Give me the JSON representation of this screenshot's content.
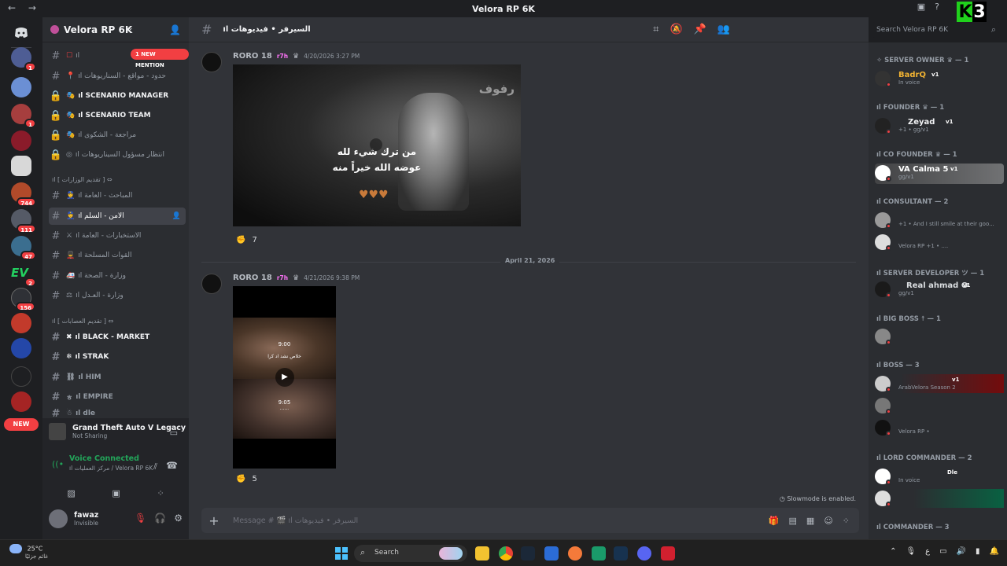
{
  "window": {
    "title": "Velora RP 6K",
    "back": "←",
    "forward": "→"
  },
  "watermark": {
    "k": "K",
    "n": "3"
  },
  "guilds": {
    "badges": [
      "1",
      "1",
      "1",
      "744",
      "111",
      "47",
      "2",
      "156"
    ],
    "ev_label": "EV",
    "new_label": "NEW"
  },
  "sidebar": {
    "server_name": "Velora RP 6K",
    "mention_pill": "1 NEW MENTION",
    "channels": [
      {
        "label": "ıl",
        "icon": "☐",
        "type": "hash"
      },
      {
        "label": "ıl حدود - مواقع - السناريوهات",
        "icon": "📍",
        "type": "hash"
      },
      {
        "label": "ıl SCENARIO MANAGER",
        "icon": "🎭",
        "type": "lock",
        "bold": true
      },
      {
        "label": "ıl SCENARIO TEAM",
        "icon": "🎭",
        "type": "lock",
        "bold": true
      },
      {
        "label": "ıl مراجعة - الشكوى",
        "icon": "🎭",
        "type": "lock"
      },
      {
        "label": "ıl انتظار مسؤول السيناريوهات",
        "icon": "◎",
        "type": "lock"
      }
    ],
    "cat1": "ıl [ تقديم الوزارات ] ⇔",
    "channels2": [
      {
        "label": "ıl المباحث - العامة",
        "icon": "👮",
        "type": "hash"
      },
      {
        "label": "ıl الامن - السلم",
        "icon": "👮",
        "type": "hash",
        "active": true
      },
      {
        "label": "ıl الاستخبارات - العامة",
        "icon": "⚔",
        "type": "hash"
      },
      {
        "label": "ıl القوات المسلحة",
        "icon": "💂",
        "type": "hash"
      },
      {
        "label": "ıl وزارة - الصحة",
        "icon": "🚑",
        "type": "hash"
      },
      {
        "label": "ıl وزارة - العـدل",
        "icon": "⚖",
        "type": "hash"
      }
    ],
    "cat2": "ıl [ تقديم العصابات ] ⇔",
    "channels3": [
      {
        "label": "ıl BLACK - MARKET",
        "icon": "✖",
        "type": "hash",
        "bold": true
      },
      {
        "label": "ıl STRAK",
        "icon": "❄",
        "type": "hash",
        "bold": true
      },
      {
        "label": "ıl HIM",
        "icon": "⛓",
        "type": "hash",
        "bold": false
      },
      {
        "label": "ıl EMPIRE",
        "icon": "ㅎ",
        "type": "hash",
        "bold": false
      },
      {
        "label": "ıl dle",
        "icon": "☃",
        "type": "hash",
        "bold": false
      }
    ],
    "game": {
      "title": "Grand Theft Auto V Legacy",
      "status": "Not Sharing"
    },
    "voice": {
      "status": "Voice Connected",
      "channel": "ıl مركز العمليات / Velora RP 6K"
    },
    "user": {
      "name": "fawaz",
      "status": "Invisible"
    }
  },
  "chat": {
    "channel_name": "ıl السيرفر • فيديوهات",
    "search_placeholder": "Search Velora RP 6K",
    "messages": [
      {
        "author": "RORO 18",
        "tag": "r7h",
        "time": "4/20/2026 3:27 PM",
        "caption1": "من ترك شيء لله",
        "caption2": "عوضه الله خيراً منه",
        "watermark": "رفوف",
        "reaction_count": "7"
      },
      {
        "author": "RORO 18",
        "tag": "r7h",
        "time": "4/21/2026 9:38 PM",
        "t1": "9:00",
        "t1sub": "خلاص نشد اد كرا",
        "t2": "9:05",
        "t2sub": "......",
        "reaction_count": "5"
      }
    ],
    "date_divider": "April 21, 2026",
    "slowmode": "Slowmode is enabled.",
    "composer_placeholder": "Message # 🎬 ıl السيرفر • فيديوهات"
  },
  "members": {
    "roles": [
      {
        "label": "✧ SERVER OWNER ♛ — 1"
      },
      {
        "label": "ıl FOUNDER ♛ — 1"
      },
      {
        "label": "ıl CO FOUNDER ♛ — 1"
      },
      {
        "label": "ıl CONSULTANT — 2"
      },
      {
        "label": "ıl SERVER DEVELOPER ツ — 1"
      },
      {
        "label": "ıl BIG BOSS ☨ — 1"
      },
      {
        "label": "ıl BOSS — 3"
      },
      {
        "label": "ıl LORD COMMANDER — 2"
      },
      {
        "label": "ıl COMMANDER — 3"
      }
    ],
    "list": [
      {
        "name": "BadrQ",
        "sub": "In voice",
        "badge": "v1",
        "color": "#f0b232"
      },
      {
        "name": "Zeyad",
        "sub": "+1 • gg/v1",
        "badge": "v1",
        "color": "#f2f3f5"
      },
      {
        "name": "VA Calma 5",
        "sub": "gg/v1",
        "badge": "v1",
        "color": "#ffffff"
      },
      {
        "name": "",
        "sub": "+1 • And I still smile at their goo...",
        "badge": "",
        "color": "#f2f3f5"
      },
      {
        "name": "",
        "sub": "Velora RP +1 • ....",
        "badge": "",
        "color": "#f2f3f5"
      },
      {
        "name": "Real ahmad O",
        "sub": "gg/v1",
        "badge": "v1",
        "color": "#f2f3f5"
      },
      {
        "name": "",
        "sub": "",
        "badge": "",
        "color": "#f2f3f5"
      },
      {
        "name": "",
        "sub": "ArabVelora Season 2",
        "badge": "v1",
        "color": "#f23f42"
      },
      {
        "name": "",
        "sub": "",
        "badge": "",
        "color": "#f2f3f5"
      },
      {
        "name": "",
        "sub": "Velora RP • ",
        "badge": "",
        "color": "#f2f3f5"
      },
      {
        "name": "",
        "sub": "In voice",
        "badge": "Dle",
        "color": "#f2f3f5"
      },
      {
        "name": "",
        "sub": "",
        "badge": "",
        "color": "#f2f3f5"
      }
    ]
  },
  "taskbar": {
    "temp": "25°C",
    "weather_desc": "غائم جزئيًا",
    "search": "Search"
  }
}
